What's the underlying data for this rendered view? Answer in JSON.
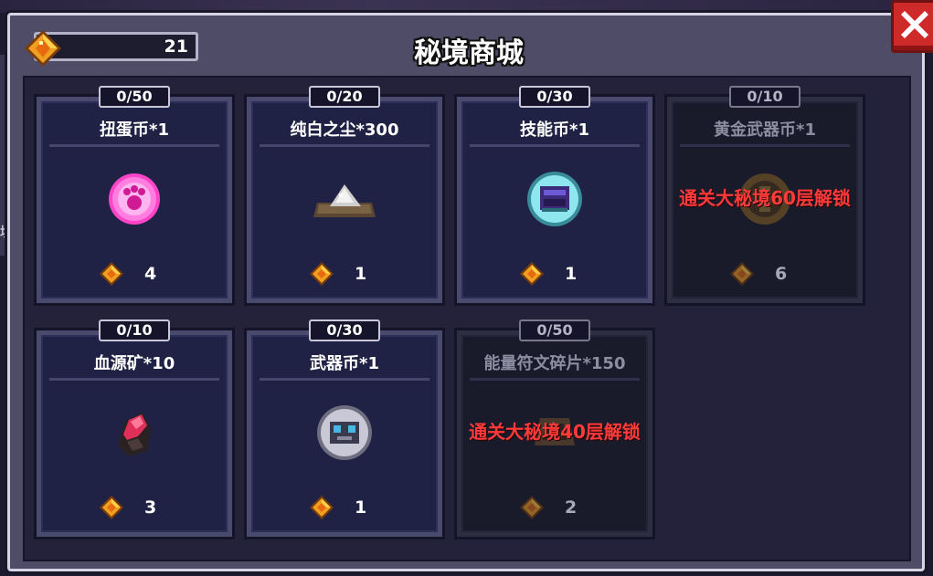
{
  "shop": {
    "title": "秘境商城",
    "currency_amount": "21",
    "currency_icon": "gem-icon",
    "close_icon": "close-icon"
  },
  "items": [
    {
      "stock": "0/50",
      "name": "扭蛋币*1",
      "price": "4",
      "icon": "gacha-coin-icon",
      "locked": false,
      "lock_text": ""
    },
    {
      "stock": "0/20",
      "name": "纯白之尘*300",
      "price": "1",
      "icon": "white-dust-icon",
      "locked": false,
      "lock_text": ""
    },
    {
      "stock": "0/30",
      "name": "技能币*1",
      "price": "1",
      "icon": "skill-coin-icon",
      "locked": false,
      "lock_text": ""
    },
    {
      "stock": "0/10",
      "name": "黄金武器币*1",
      "price": "6",
      "icon": "gold-weapon-coin-icon",
      "locked": true,
      "lock_text": "通关大秘境60层解锁"
    },
    {
      "stock": "0/10",
      "name": "血源矿*10",
      "price": "3",
      "icon": "blood-ore-icon",
      "locked": false,
      "lock_text": ""
    },
    {
      "stock": "0/30",
      "name": "武器币*1",
      "price": "1",
      "icon": "weapon-coin-icon",
      "locked": false,
      "lock_text": ""
    },
    {
      "stock": "0/50",
      "name": "能量符文碎片*150",
      "price": "2",
      "icon": "rune-fragment-icon",
      "locked": true,
      "lock_text": "通关大秘境40层解锁"
    }
  ],
  "colors": {
    "lock_text": "#ff3a3a",
    "gem": "#f0a020",
    "close_button": "#cf2a2a"
  }
}
